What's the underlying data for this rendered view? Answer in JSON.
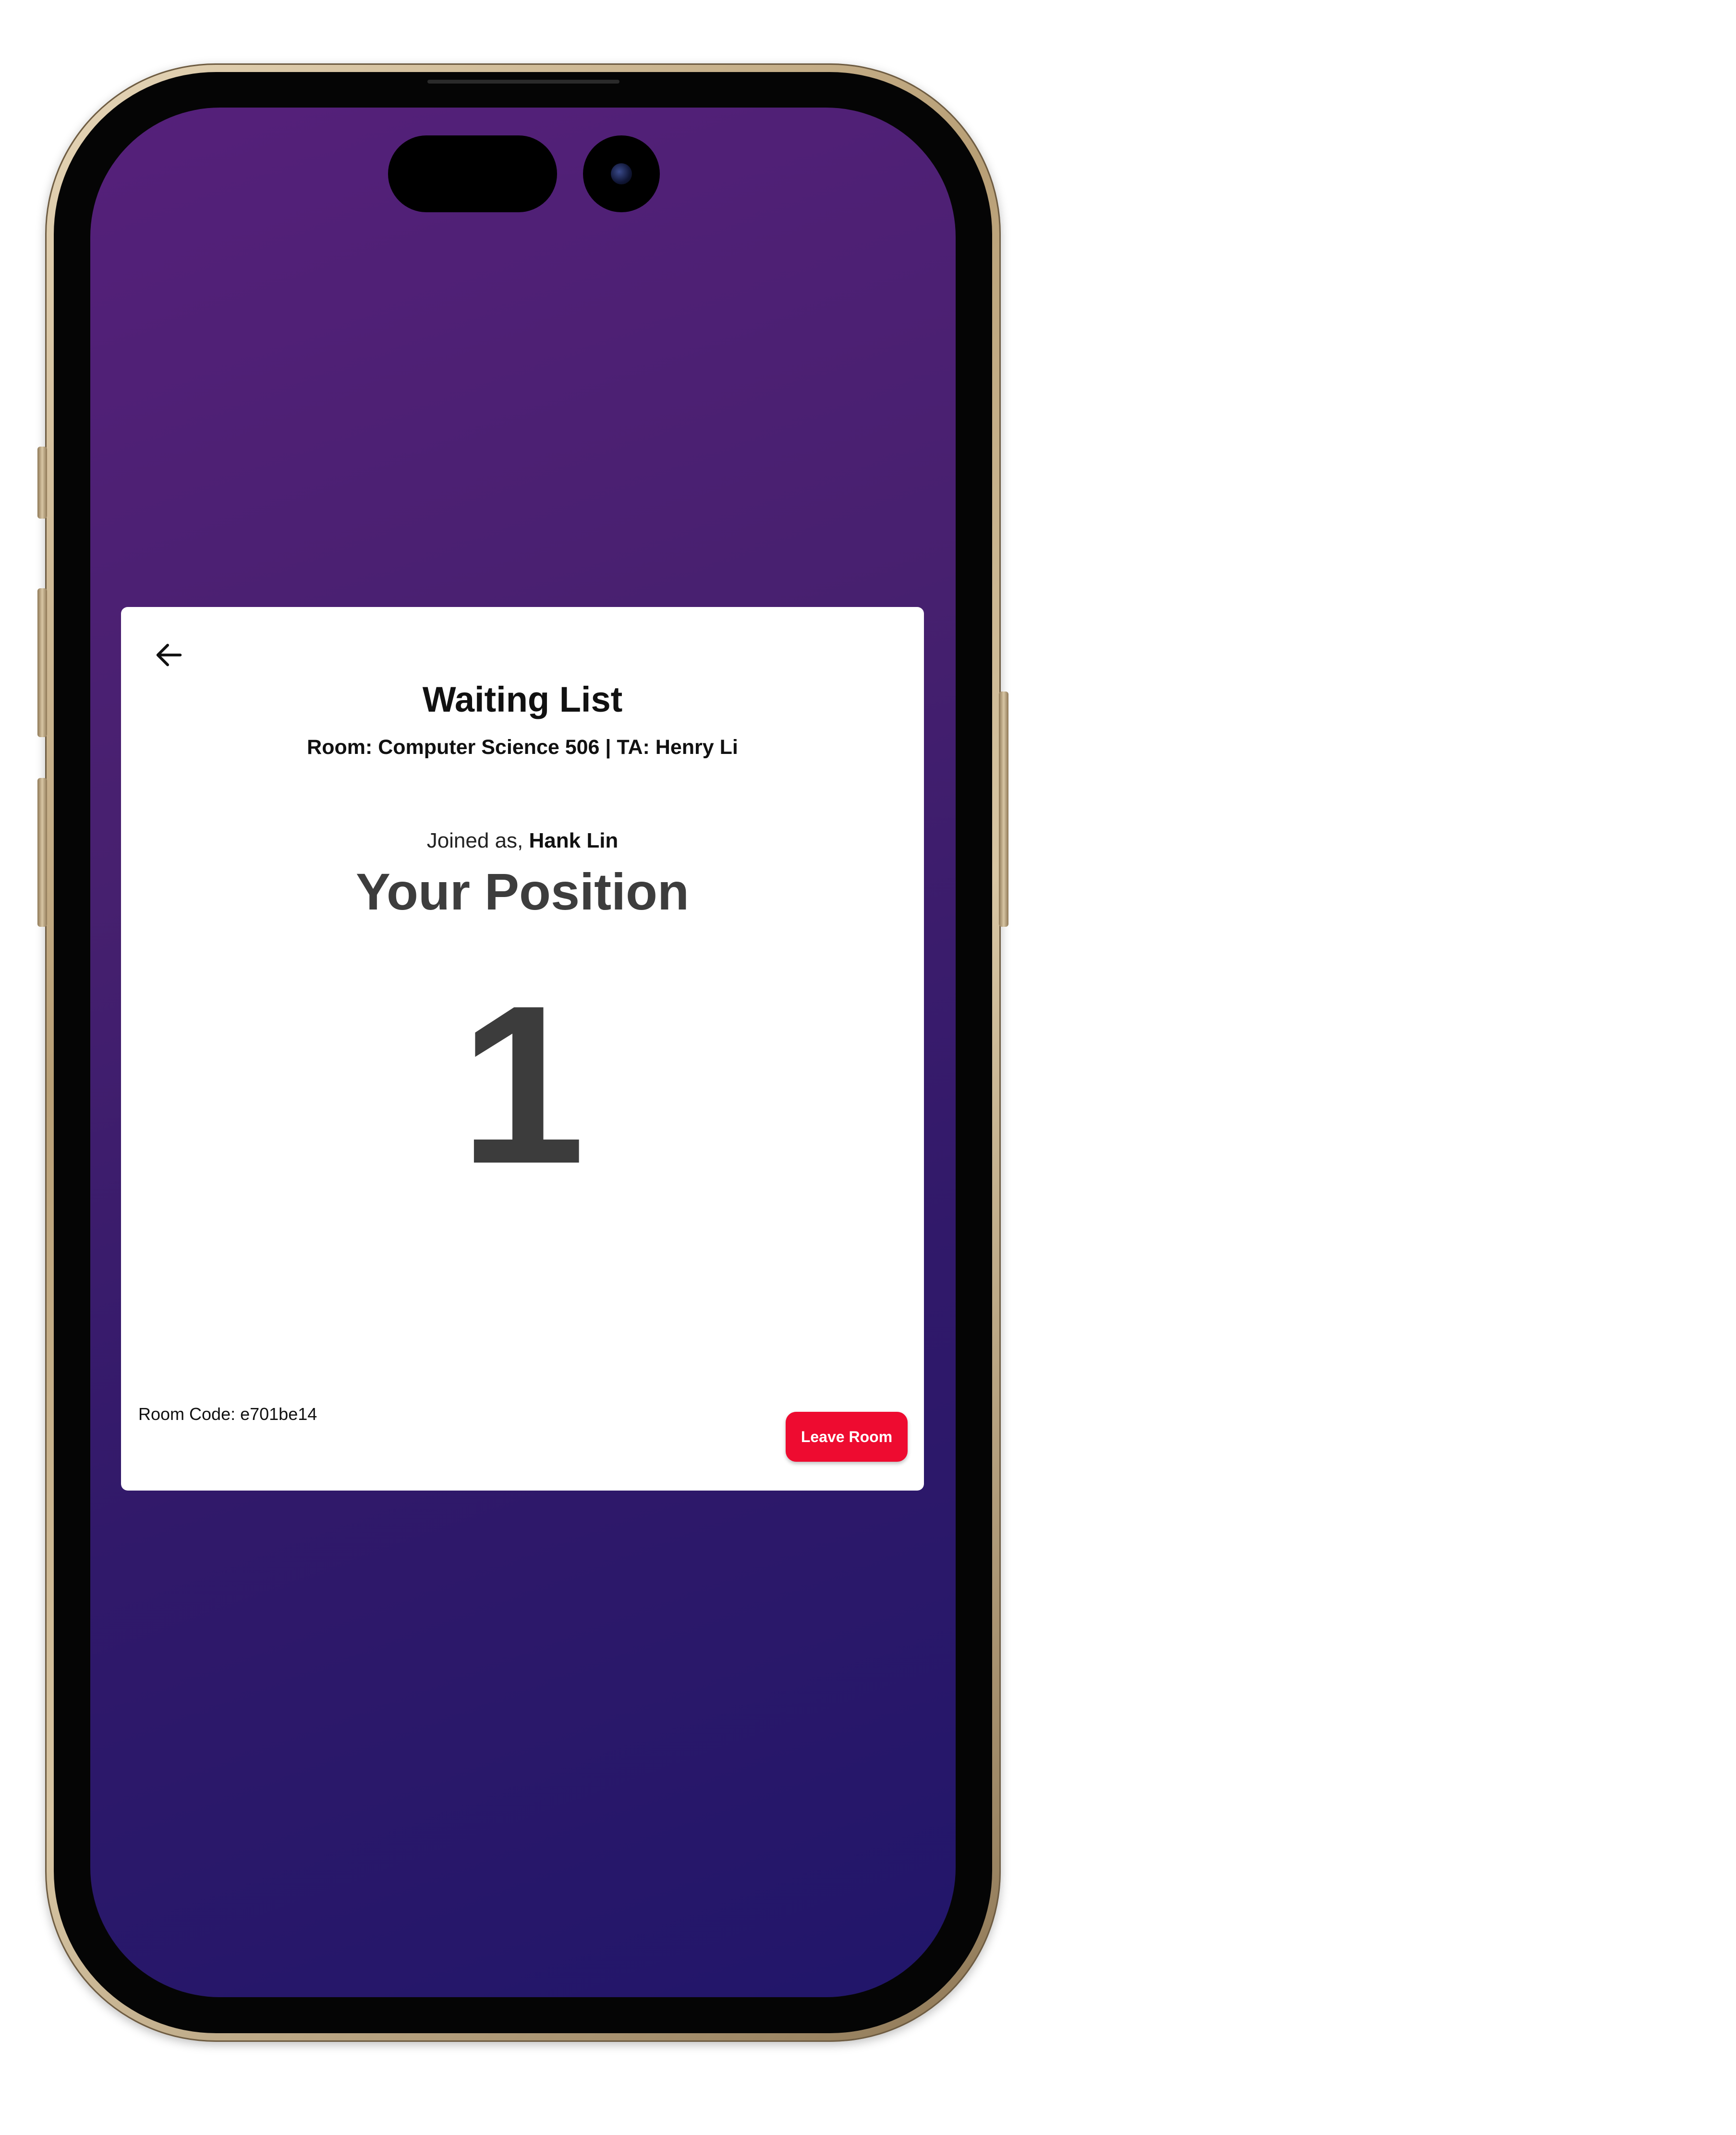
{
  "screen": {
    "background_gradient": [
      "#55207a",
      "#21166a"
    ]
  },
  "header": {
    "back_icon": "arrow-left-icon",
    "title": "Waiting List",
    "subtitle": "Room: Computer Science 506 | TA: Henry Li"
  },
  "status": {
    "joined_prefix": "Joined as, ",
    "joined_name": "Hank Lin",
    "position_heading": "Your Position",
    "position_number": "1"
  },
  "footer": {
    "room_code": "Room Code: e701be14",
    "leave_label": "Leave Room",
    "leave_color": "#ee0b30"
  }
}
